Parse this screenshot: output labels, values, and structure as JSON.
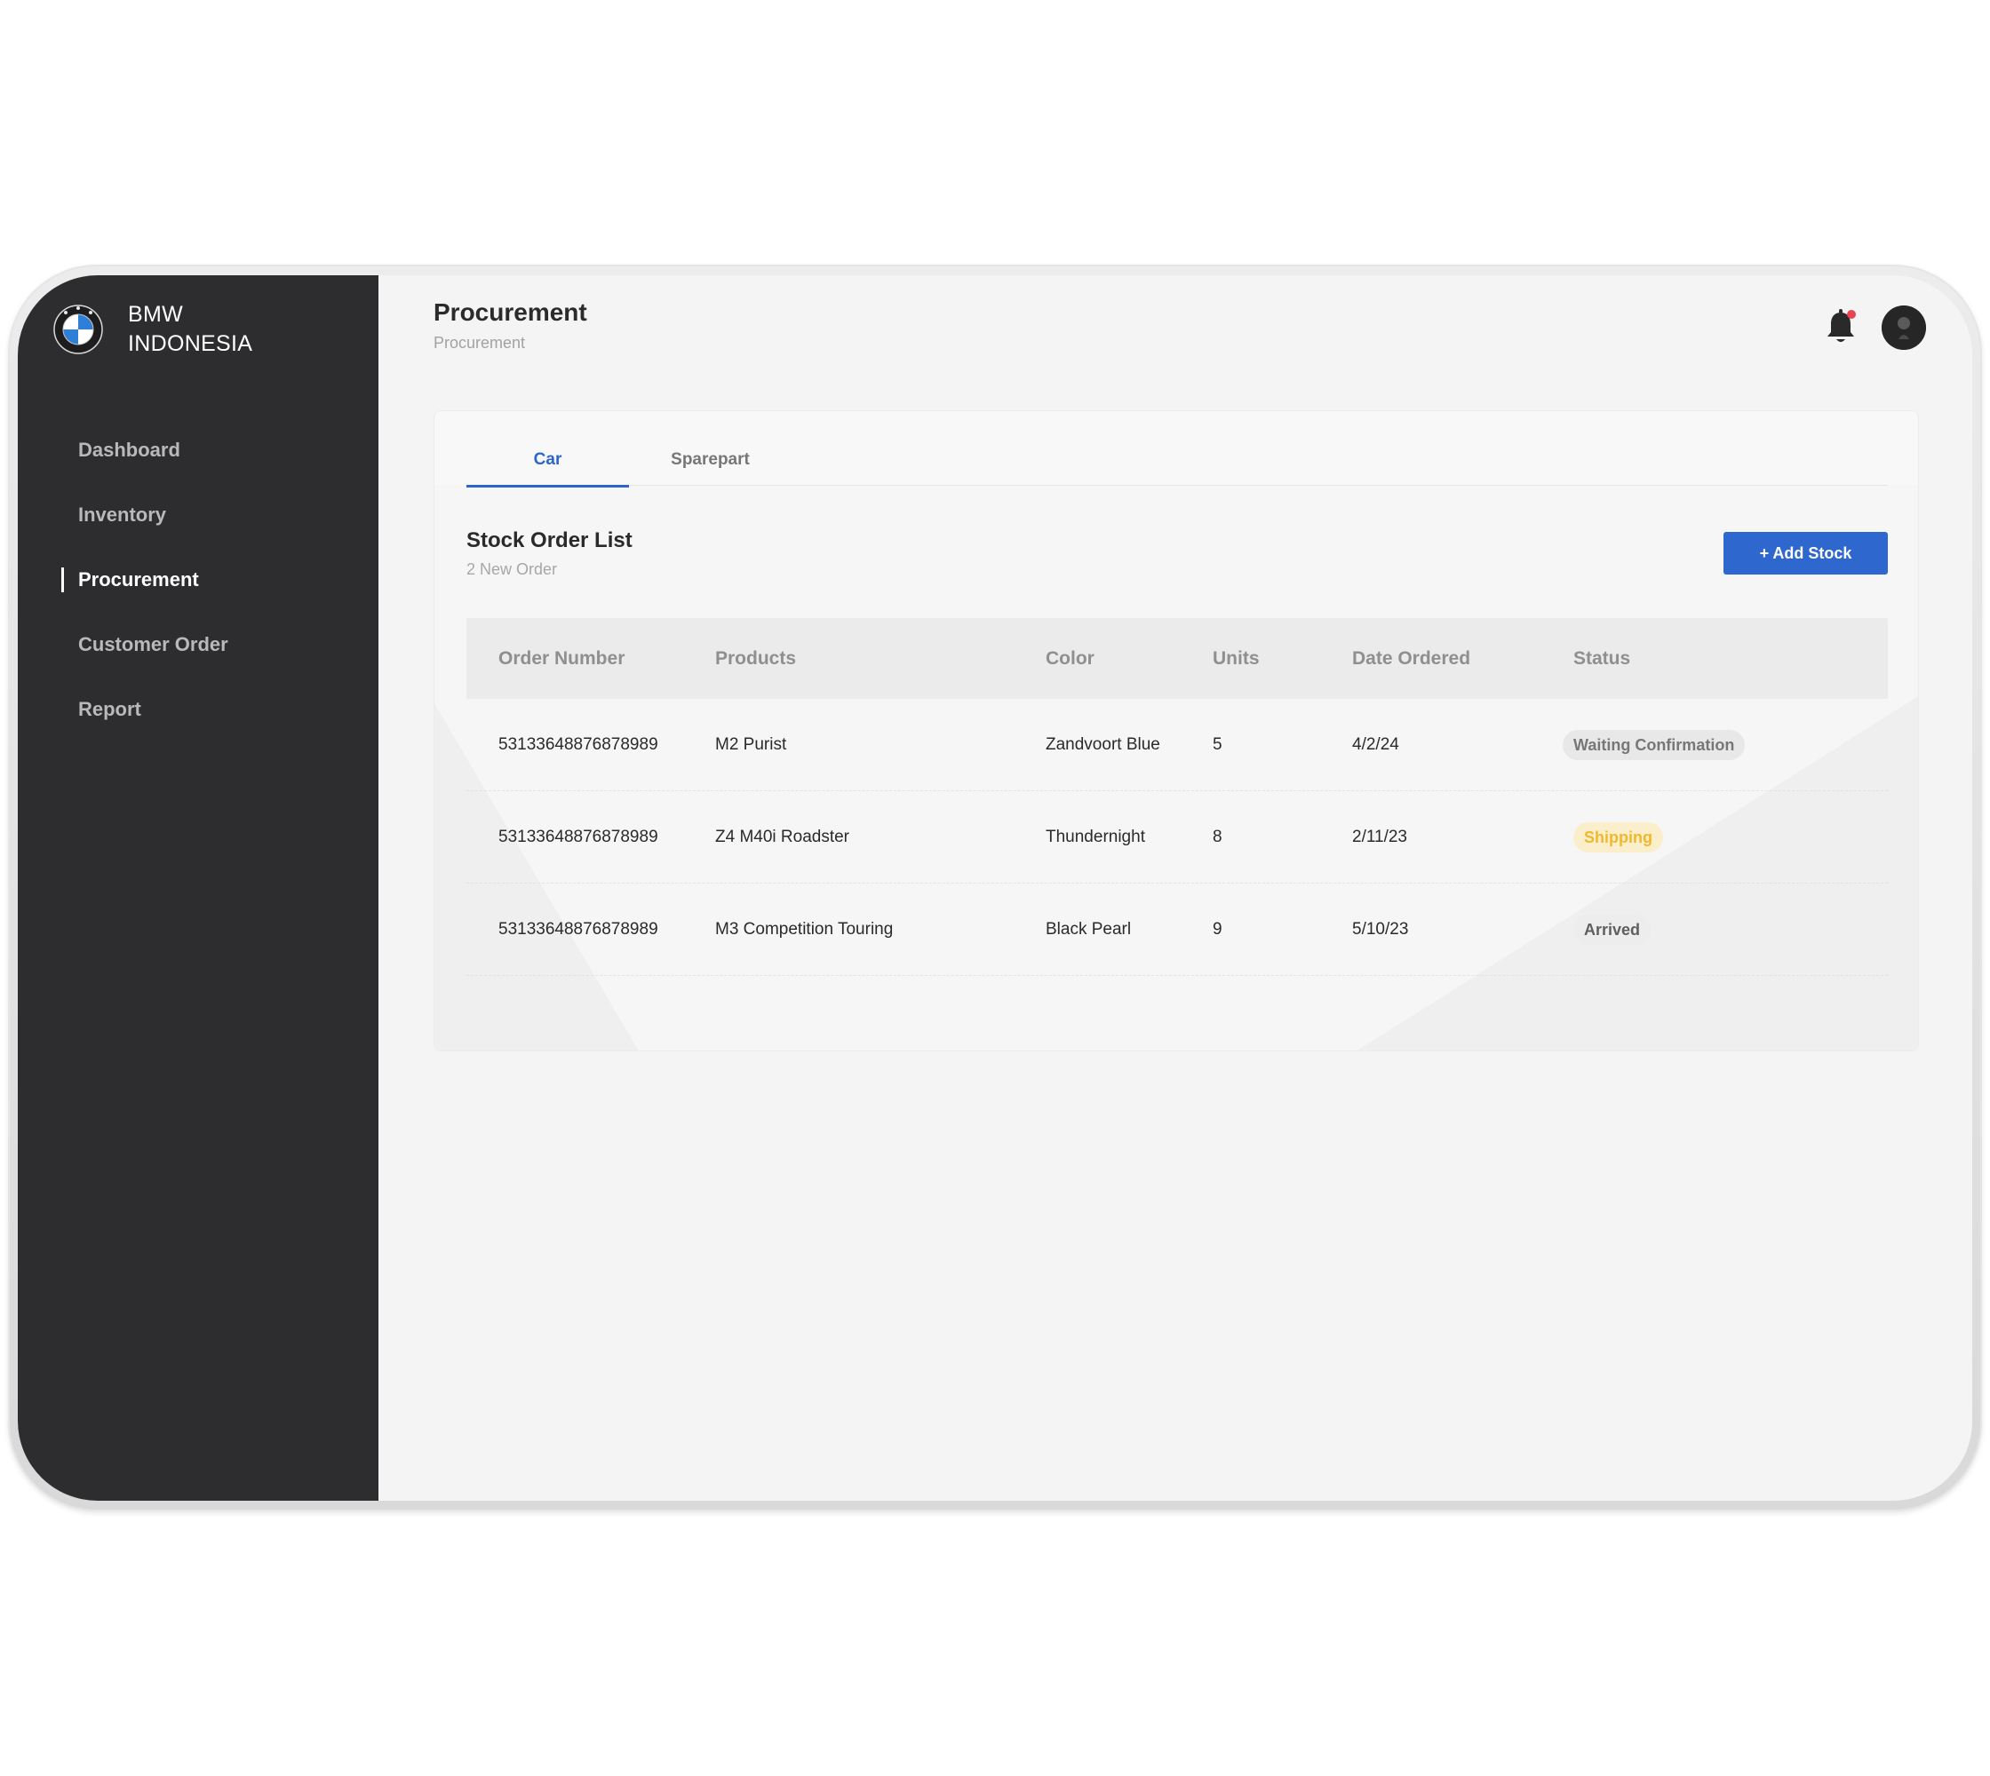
{
  "brand": {
    "line1": "BMW",
    "line2": "INDONESIA"
  },
  "sidebar": {
    "items": [
      {
        "label": "Dashboard",
        "active": false
      },
      {
        "label": "Inventory",
        "active": false
      },
      {
        "label": "Procurement",
        "active": true
      },
      {
        "label": "Customer Order",
        "active": false
      },
      {
        "label": "Report",
        "active": false
      }
    ]
  },
  "header": {
    "title": "Procurement",
    "breadcrumb": "Procurement",
    "icons": {
      "notifications": "bell-icon",
      "profile": "avatar"
    },
    "notification_dot_color": "#e8434f"
  },
  "tabs": [
    {
      "label": "Car",
      "active": true
    },
    {
      "label": "Sparepart",
      "active": false
    }
  ],
  "section": {
    "title": "Stock Order List",
    "subtitle": "2 New Order",
    "add_button_label": "+ Add Stock"
  },
  "table": {
    "columns": [
      "Order Number",
      "Products",
      "Color",
      "Units",
      "Date Ordered",
      "Status"
    ],
    "rows": [
      {
        "order_number": "53133648876878989",
        "product": "M2 Purist",
        "color": "Zandvoort Blue",
        "units": "5",
        "date": "4/2/24",
        "status": "Waiting Confirmation"
      },
      {
        "order_number": "53133648876878989",
        "product": "Z4 M40i Roadster",
        "color": "Thundernight",
        "units": "8",
        "date": "2/11/23",
        "status": "Shipping"
      },
      {
        "order_number": "53133648876878989",
        "product": "M3 Competition Touring",
        "color": "Black Pearl",
        "units": "9",
        "date": "5/10/23",
        "status": "Arrived"
      }
    ]
  },
  "colors": {
    "accent": "#2e68cf",
    "sidebar_bg": "#2d2d2f",
    "status_waiting": "#777777",
    "status_shipping": "#f1b82d",
    "status_arrived": "#5f5f5f"
  }
}
